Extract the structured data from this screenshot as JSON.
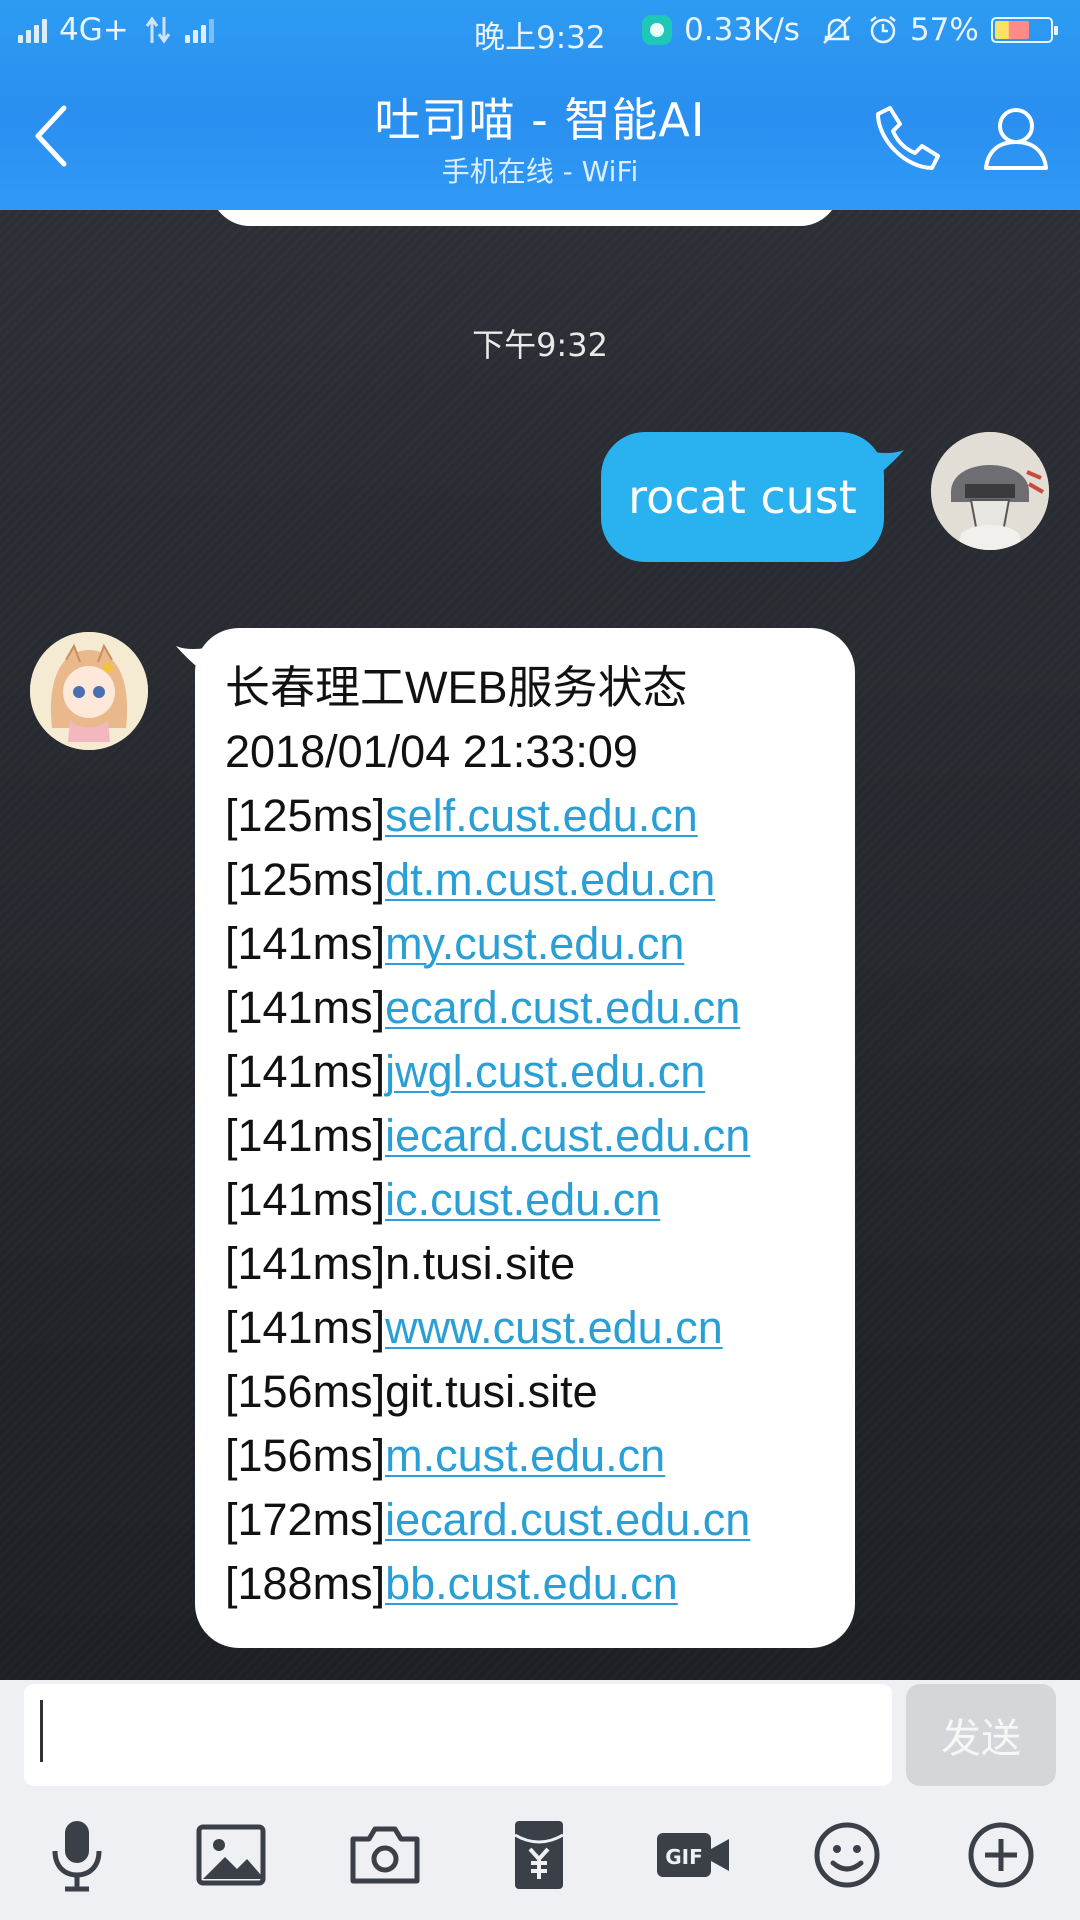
{
  "status_bar": {
    "network": "4G+",
    "time": "晚上9:32",
    "speed": "0.33K/s",
    "battery": "57%",
    "battery_level": 0.57
  },
  "header": {
    "title": "吐司喵 - 智能AI",
    "subtitle": "手机在线 - WiFi",
    "icons": {
      "back": "back-arrow-icon",
      "call": "phone-icon",
      "profile": "person-icon"
    }
  },
  "chat": {
    "timestamp": "下午9:32",
    "outgoing": {
      "text": "rocat cust"
    },
    "incoming": {
      "title": "长春理工WEB服务状态",
      "datetime": "2018/01/04 21:33:09",
      "entries": [
        {
          "latency": "[125ms]",
          "host": "self.cust.edu.cn",
          "link": true
        },
        {
          "latency": "[125ms]",
          "host": "dt.m.cust.edu.cn",
          "link": true
        },
        {
          "latency": "[141ms]",
          "host": "my.cust.edu.cn",
          "link": true
        },
        {
          "latency": "[141ms]",
          "host": "ecard.cust.edu.cn",
          "link": true
        },
        {
          "latency": "[141ms]",
          "host": "jwgl.cust.edu.cn",
          "link": true
        },
        {
          "latency": "[141ms]",
          "host": "iecard.cust.edu.cn",
          "link": true
        },
        {
          "latency": "[141ms]",
          "host": "ic.cust.edu.cn",
          "link": true
        },
        {
          "latency": "[141ms]",
          "host": "n.tusi.site",
          "link": false
        },
        {
          "latency": "[141ms]",
          "host": "www.cust.edu.cn",
          "link": true
        },
        {
          "latency": "[156ms]",
          "host": "git.tusi.site",
          "link": false
        },
        {
          "latency": "[156ms]",
          "host": "m.cust.edu.cn",
          "link": true
        },
        {
          "latency": "[172ms]",
          "host": "iecard.cust.edu.cn",
          "link": true
        },
        {
          "latency": "[188ms]",
          "host": "bb.cust.edu.cn",
          "link": true
        }
      ]
    }
  },
  "input": {
    "value": "",
    "send_label": "发送"
  },
  "toolbar": {
    "icons": [
      "microphone-icon",
      "image-icon",
      "camera-icon",
      "red-packet-icon",
      "gif-icon",
      "emoji-icon",
      "plus-icon"
    ]
  },
  "colors": {
    "header_blue": "#2a8ff0",
    "outgoing_bubble": "#2ab1f0",
    "link": "#2a9fd6",
    "toolbar_bg": "#eef0f4"
  }
}
